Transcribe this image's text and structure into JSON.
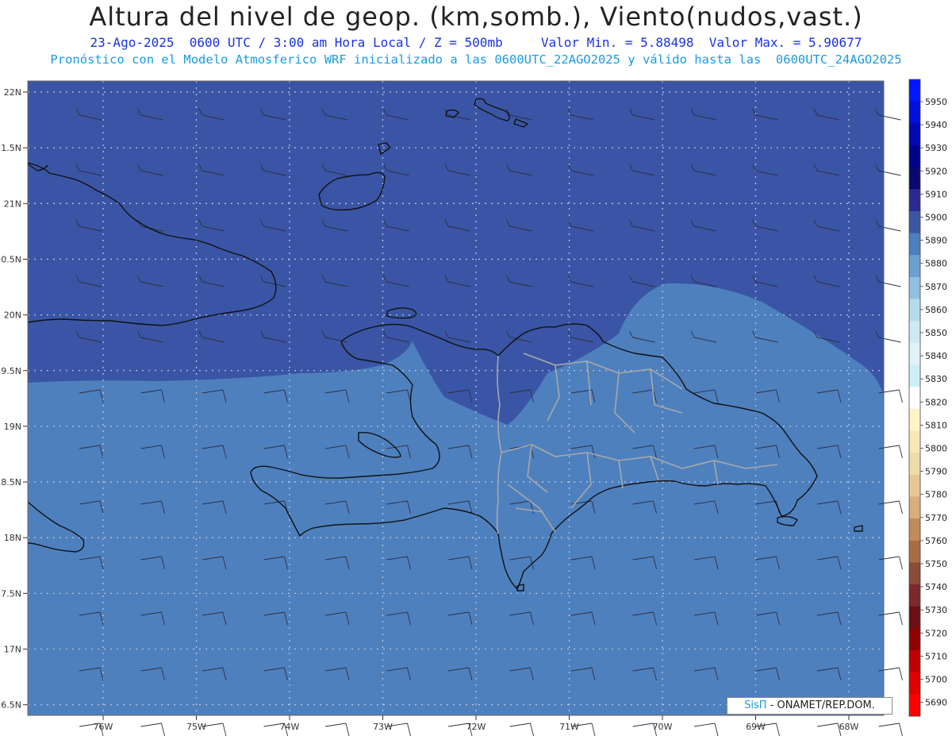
{
  "header": {
    "title": "Altura del nivel de geop. (km,somb.), Viento(nudos,vast.)",
    "line1": "23-Ago-2025  0600 UTC / 3:00 am Hora Local / Z = 500mb     Valor Min. = 5.88498  Valor Max. = 5.90677",
    "line2": "Pronóstico con el Modelo Atmosferico WRF inicializado a las 0600UTC_22AGO2025 y válido hasta las  0600UTC_24AGO2025"
  },
  "credit": {
    "brand": "SisΠ",
    "text": " - ONAMET/REP.DOM."
  },
  "lat_labels": [
    "22N",
    "21.5N",
    "21N",
    "20.5N",
    "20N",
    "19.5N",
    "19N",
    "18.5N",
    "18N",
    "17.5N",
    "17N",
    "16.5N"
  ],
  "lat_values": [
    22,
    21.5,
    21,
    20.5,
    20,
    19.5,
    19,
    18.5,
    18,
    17.5,
    17,
    16.5
  ],
  "lon_labels": [
    "76W",
    "75W",
    "74W",
    "73W",
    "72W",
    "71W",
    "70W",
    "69W",
    "68W"
  ],
  "lon_values": [
    -76,
    -75,
    -74,
    -73,
    -72,
    -71,
    -70,
    -69,
    -68
  ],
  "colorbar": {
    "levels": [
      5950,
      5940,
      5930,
      5920,
      5910,
      5900,
      5890,
      5880,
      5870,
      5860,
      5850,
      5840,
      5830,
      5820,
      5810,
      5800,
      5790,
      5780,
      5770,
      5760,
      5750,
      5740,
      5730,
      5720,
      5710,
      5700,
      5690
    ],
    "colors": [
      "#0018ff",
      "#0010d8",
      "#000ab0",
      "#00038a",
      "#0b0970",
      "#2a2a92",
      "#3c56a4",
      "#4e7fbf",
      "#6d9fcf",
      "#92c1df",
      "#b4dbeb",
      "#cde9f2",
      "#e0f3f8",
      "#cdf0f7",
      "#ffffff",
      "#fff4c8",
      "#f8e8b6",
      "#f0dbaa",
      "#e7c794",
      "#d9ad7c",
      "#c28b5a",
      "#aa6c44",
      "#8d4a37",
      "#7a2a2a",
      "#6b0f12",
      "#900000",
      "#c00000",
      "#e00000",
      "#ff0000"
    ]
  },
  "fills": {
    "north": "#3a55a5",
    "south": "#4e80be"
  }
}
